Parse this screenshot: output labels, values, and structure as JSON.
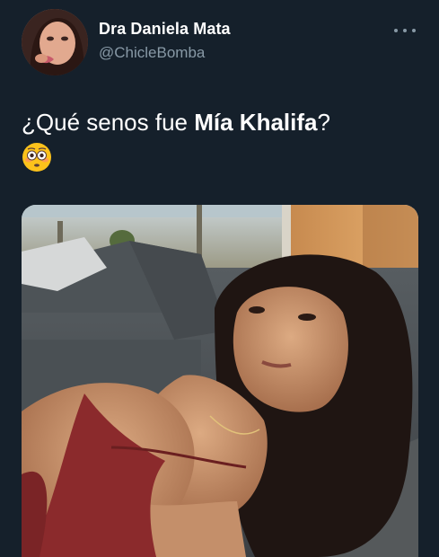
{
  "user": {
    "display_name": "Dra Daniela Mata",
    "handle": "@ChicleBomba"
  },
  "tweet": {
    "text_part1": "¿Qué senos fue ",
    "text_bold": "Mía Khalifa",
    "text_part2": "?",
    "emoji": "flushed-face-emoji"
  },
  "colors": {
    "background": "#15202b",
    "secondary_text": "#8899a6",
    "primary_text": "#ffffff"
  },
  "icons": {
    "more": "more-horizontal-icon"
  }
}
